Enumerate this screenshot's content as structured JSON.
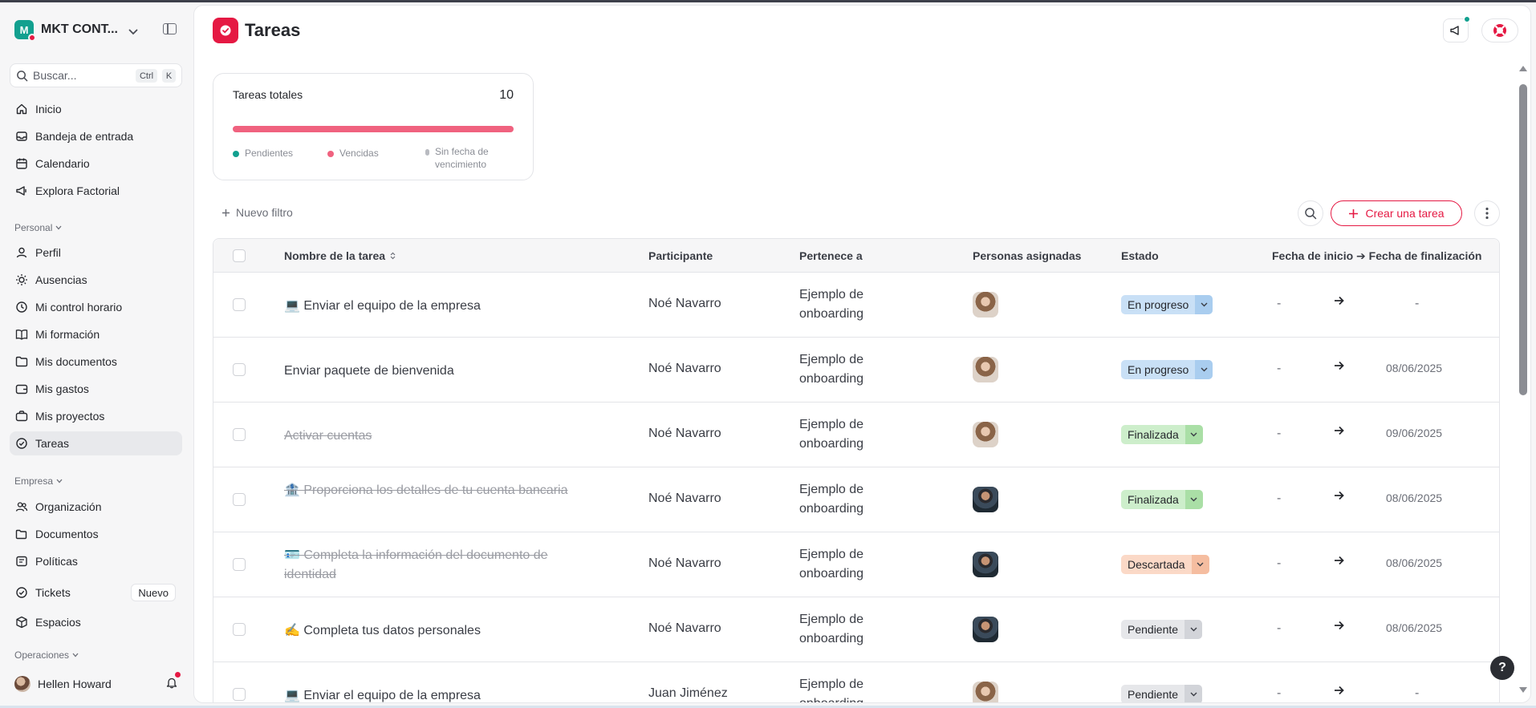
{
  "workspace": {
    "initial": "M",
    "name": "MKT CONT..."
  },
  "search": {
    "placeholder": "Buscar...",
    "key1": "Ctrl",
    "key2": "K"
  },
  "nav_main": [
    {
      "label": "Inicio",
      "icon": "home-icon"
    },
    {
      "label": "Bandeja de entrada",
      "icon": "inbox-icon"
    },
    {
      "label": "Calendario",
      "icon": "calendar-icon"
    },
    {
      "label": "Explora Factorial",
      "icon": "megaphone-icon"
    }
  ],
  "section_personal": "Personal",
  "nav_personal": [
    {
      "label": "Perfil",
      "icon": "user-icon"
    },
    {
      "label": "Ausencias",
      "icon": "sun-icon"
    },
    {
      "label": "Mi control horario",
      "icon": "clock-icon"
    },
    {
      "label": "Mi formación",
      "icon": "book-icon"
    },
    {
      "label": "Mis documentos",
      "icon": "folder-icon"
    },
    {
      "label": "Mis gastos",
      "icon": "wallet-icon"
    },
    {
      "label": "Mis proyectos",
      "icon": "briefcase-icon"
    },
    {
      "label": "Tareas",
      "icon": "check-circle-icon",
      "active": true
    }
  ],
  "section_empresa": "Empresa",
  "nav_empresa": [
    {
      "label": "Organización",
      "icon": "people-icon"
    },
    {
      "label": "Documentos",
      "icon": "folders-icon"
    },
    {
      "label": "Políticas",
      "icon": "policy-icon"
    },
    {
      "label": "Tickets",
      "icon": "ticket-icon",
      "badge": "Nuevo"
    },
    {
      "label": "Espacios",
      "icon": "cube-icon"
    }
  ],
  "section_operaciones": "Operaciones",
  "user": {
    "name": "Hellen Howard"
  },
  "page": {
    "title": "Tareas"
  },
  "summary": {
    "title": "Tareas totales",
    "count": "10",
    "bar_color": "#f0627f",
    "legend": [
      {
        "label": "Pendientes",
        "color": "#12a08f"
      },
      {
        "label": "Vencidas",
        "color": "#f0627f"
      },
      {
        "label": "Sin fecha de vencimiento",
        "color": "#b9bbc1"
      }
    ]
  },
  "toolbar": {
    "filter_label": "Nuevo filtro",
    "create_label": "Crear una tarea"
  },
  "table": {
    "columns": {
      "name": "Nombre de la tarea",
      "participant": "Participante",
      "belongs": "Pertenece a",
      "assigned": "Personas asignadas",
      "status": "Estado",
      "dates": "Fecha de inicio ➔ Fecha de finalización"
    },
    "rows": [
      {
        "name": "💻 Enviar el equipo de la empresa",
        "done": false,
        "participant": "Noé Navarro",
        "belongs": [
          "Ejemplo de",
          "onboarding"
        ],
        "avatar": "f",
        "status": "En progreso",
        "status_kind": "progress",
        "start": "-",
        "arrow": "➔",
        "end": "-"
      },
      {
        "name": "Enviar paquete de bienvenida",
        "done": false,
        "participant": "Noé Navarro",
        "belongs": [
          "Ejemplo de",
          "onboarding"
        ],
        "avatar": "f",
        "status": "En progreso",
        "status_kind": "progress",
        "start": "-",
        "arrow": "➔",
        "end": "08/06/2025"
      },
      {
        "name": "Activar cuentas",
        "done": true,
        "participant": "Noé Navarro",
        "belongs": [
          "Ejemplo de",
          "onboarding"
        ],
        "avatar": "f",
        "status": "Finalizada",
        "status_kind": "done",
        "start": "-",
        "arrow": "➔",
        "end": "09/06/2025"
      },
      {
        "name": "🏦 Proporciona los detalles de tu cuenta bancaria",
        "done": true,
        "participant": "Noé Navarro",
        "belongs": [
          "Ejemplo de",
          "onboarding"
        ],
        "avatar": "m",
        "status": "Finalizada",
        "status_kind": "done",
        "start": "-",
        "arrow": "➔",
        "end": "08/06/2025"
      },
      {
        "name": "🪪 Completa la información del documento de identidad",
        "done": true,
        "participant": "Noé Navarro",
        "belongs": [
          "Ejemplo de",
          "onboarding"
        ],
        "avatar": "m",
        "status": "Descartada",
        "status_kind": "disc",
        "start": "-",
        "arrow": "➔",
        "end": "08/06/2025"
      },
      {
        "name": "✍️ Completa tus datos personales",
        "done": false,
        "participant": "Noé Navarro",
        "belongs": [
          "Ejemplo de",
          "onboarding"
        ],
        "avatar": "m",
        "status": "Pendiente",
        "status_kind": "pend",
        "start": "-",
        "arrow": "➔",
        "end": "08/06/2025"
      },
      {
        "name": "💻 Enviar el equipo de la empresa",
        "done": false,
        "participant": "Juan Jiménez",
        "belongs": [
          "Ejemplo de",
          "onboarding"
        ],
        "avatar": "f",
        "status": "Pendiente",
        "status_kind": "pend",
        "start": "-",
        "arrow": "➔",
        "end": "-"
      }
    ]
  },
  "help_label": "?"
}
